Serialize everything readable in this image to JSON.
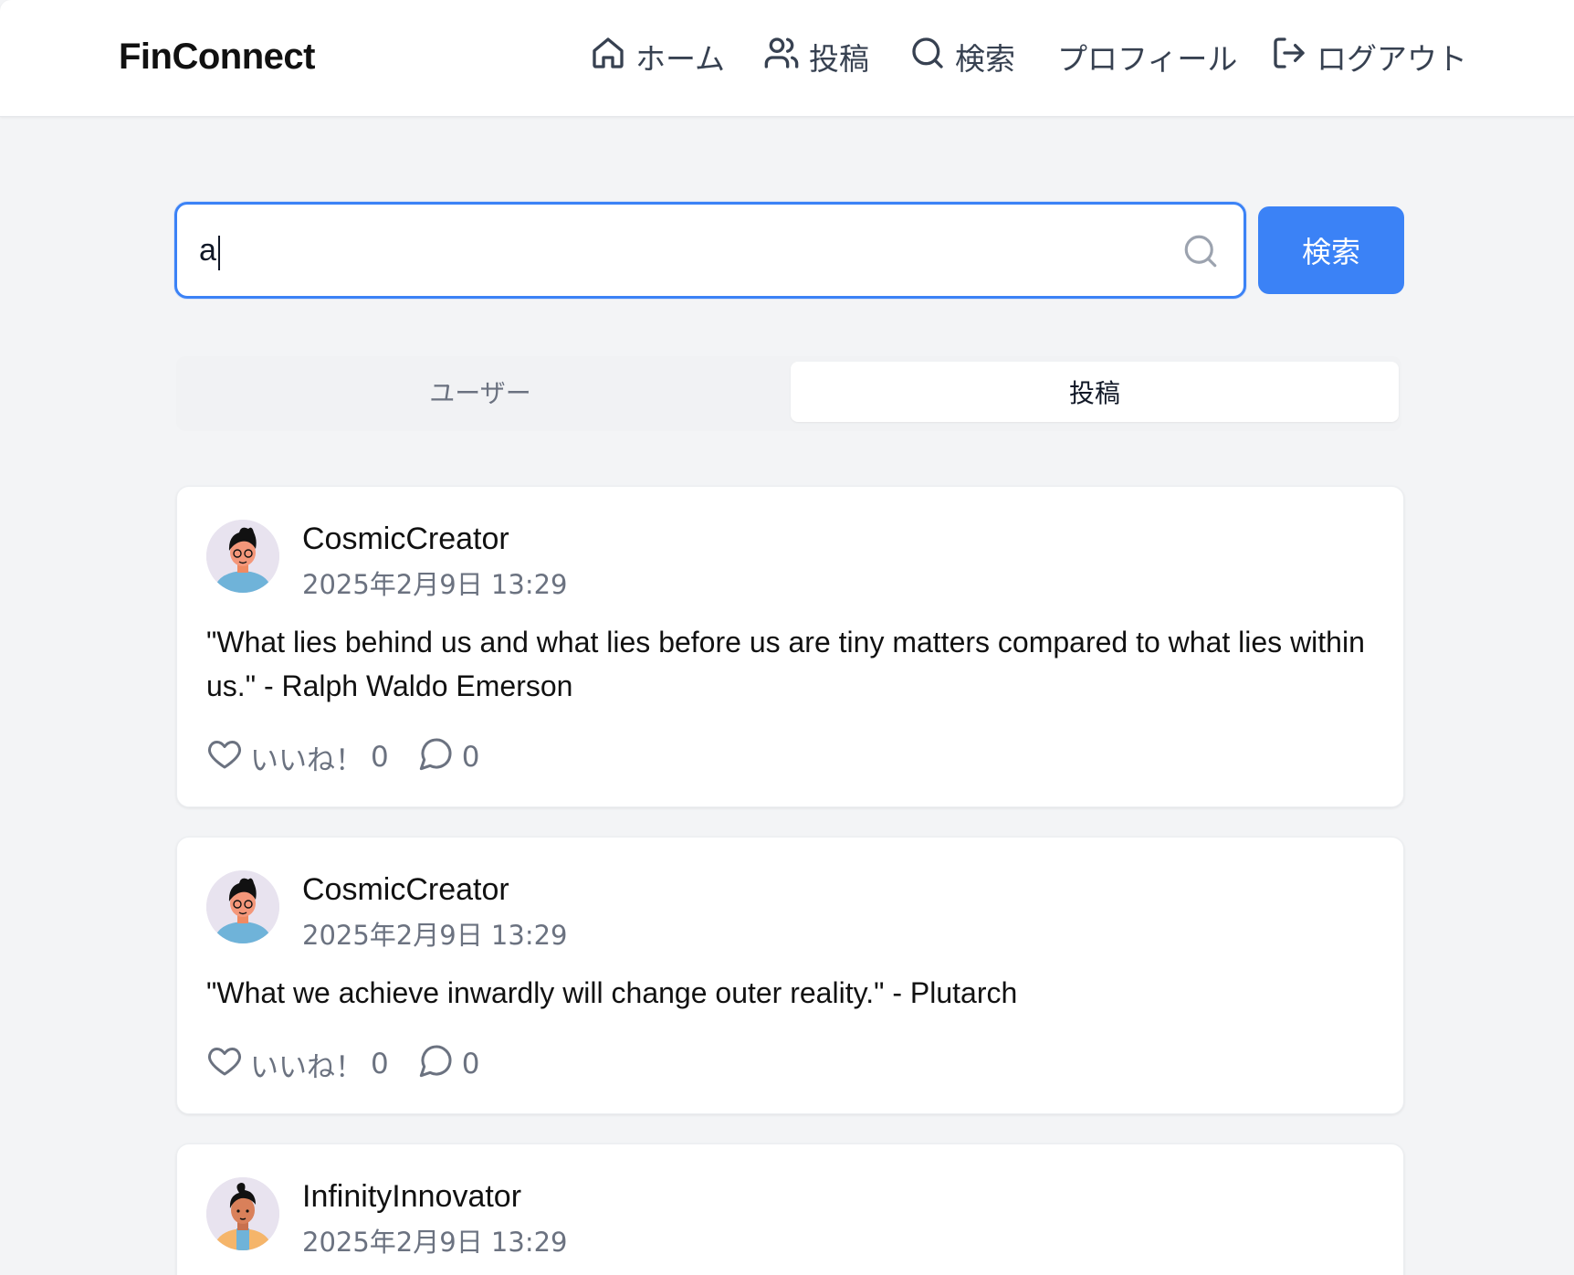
{
  "header": {
    "brand": "FinConnect",
    "nav": {
      "home": "ホーム",
      "posts": "投稿",
      "search": "検索",
      "profile": "プロフィール",
      "logout": "ログアウト"
    }
  },
  "search": {
    "value": "a",
    "button_label": "検索"
  },
  "tabs": {
    "users": "ユーザー",
    "posts": "投稿",
    "active": "posts"
  },
  "posts": [
    {
      "username": "CosmicCreator",
      "timestamp": "2025年2月9日 13:29",
      "content": "\"What lies behind us and what lies before us are tiny matters compared to what lies within us.\" - Ralph Waldo Emerson",
      "like_label": "いいね！",
      "likes": "0",
      "comments": "0"
    },
    {
      "username": "CosmicCreator",
      "timestamp": "2025年2月9日 13:29",
      "content": "\"What we achieve inwardly will change outer reality.\" - Plutarch",
      "like_label": "いいね！",
      "likes": "0",
      "comments": "0"
    },
    {
      "username": "InfinityInnovator",
      "timestamp": "2025年2月9日 13:29"
    }
  ],
  "colors": {
    "accent": "#3b82f6",
    "background": "#f3f4f6",
    "muted_text": "#6b7280"
  },
  "icons": [
    "home-icon",
    "users-icon",
    "search-icon",
    "logout-icon",
    "heart-icon",
    "comment-icon"
  ]
}
